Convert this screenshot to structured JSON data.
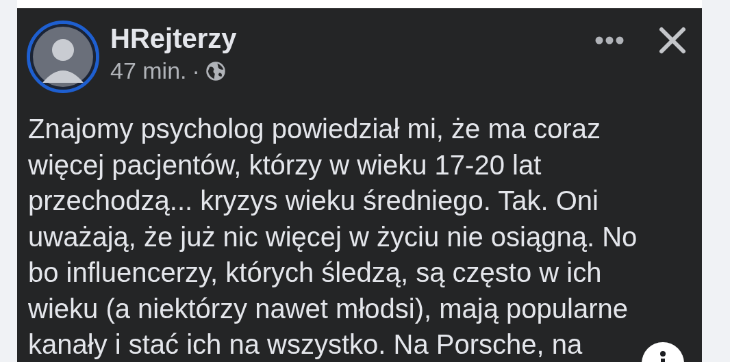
{
  "post": {
    "author": "HRejterzy",
    "time": "47 min.",
    "separator": "·",
    "body_lines": [
      "Znajomy psycholog powiedział mi, że ma coraz",
      "więcej pacjentów, którzy w wieku 17-20 lat",
      "przechodzą... kryzys wieku średniego. Tak. Oni",
      "uważają, że już nic więcej w życiu nie osiągną. No",
      "bo influencerzy, których śledzą, są często w ich",
      "wieku (a niektórzy nawet młodsi), mają popularne",
      "kanały i stać ich na wszystko. Na Porsche, na"
    ]
  }
}
